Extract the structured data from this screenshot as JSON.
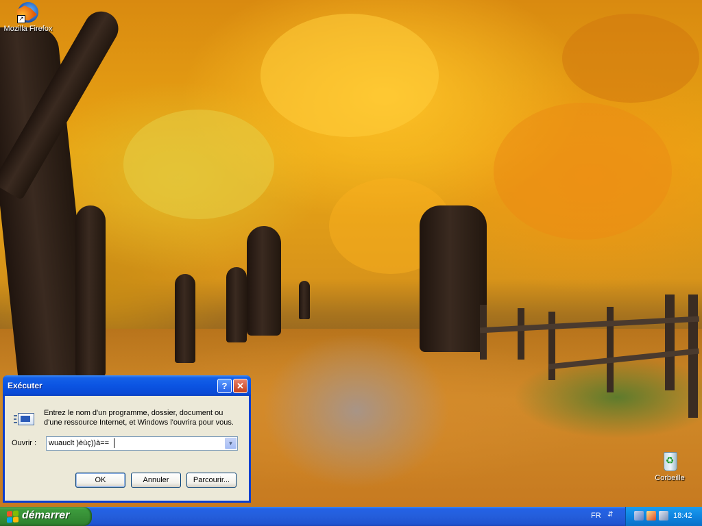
{
  "desktop": {
    "icons": [
      {
        "label": "Mozilla Firefox",
        "icon": "firefox-icon"
      },
      {
        "label": "Corbeille",
        "icon": "recycle-bin-icon"
      }
    ],
    "wallpaper": "autumn-tree-lined-path"
  },
  "run_dialog": {
    "title": "Exécuter",
    "description": "Entrez le nom d'un programme, dossier, document ou d'une ressource Internet, et Windows l'ouvrira pour vous.",
    "open_label": "Ouvrir :",
    "open_value": "wuauclt )èùç))à==",
    "buttons": {
      "ok": "OK",
      "cancel": "Annuler",
      "browse": "Parcourir..."
    },
    "help_glyph": "?",
    "close_glyph": "✕"
  },
  "taskbar": {
    "start_label": "démarrer",
    "language": "FR",
    "clock": "18:42"
  },
  "colors": {
    "taskbar_blue": "#245edb",
    "start_green": "#378f37",
    "dialog_face": "#ece9d8",
    "title_blue": "#0b54e2"
  }
}
